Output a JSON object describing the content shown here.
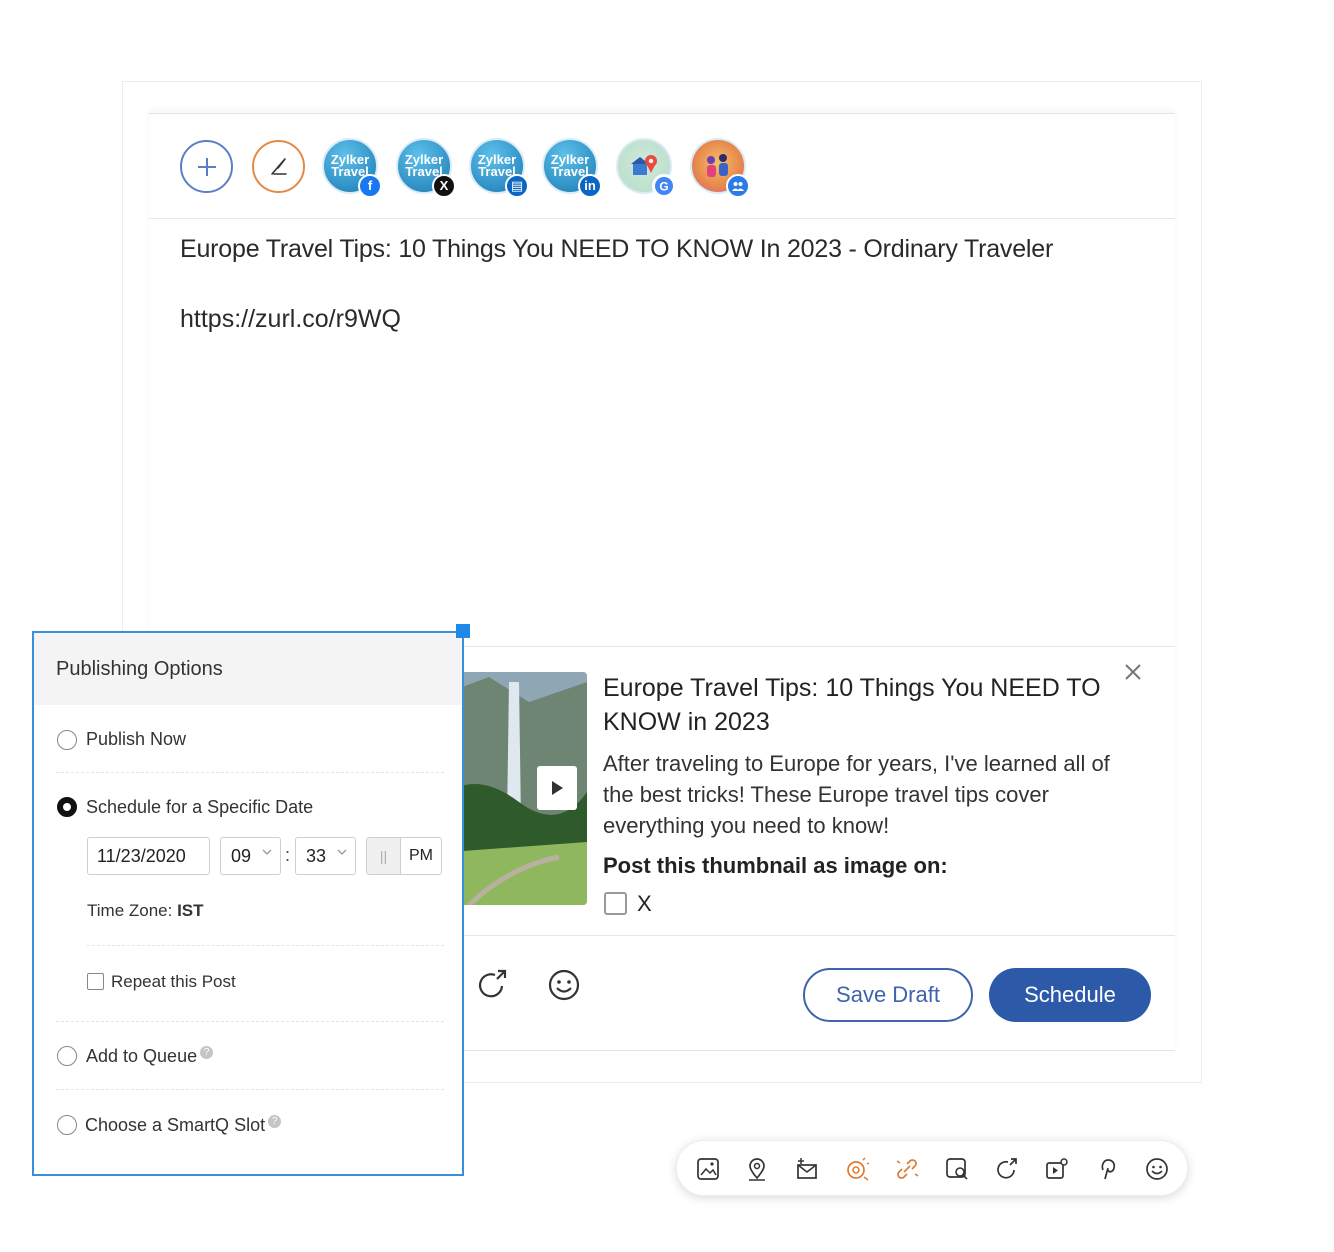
{
  "composer": {
    "post_text": "Europe Travel Tips: 10 Things You NEED TO KNOW In 2023 - Ordinary Traveler",
    "post_link": "https://zurl.co/r9WQ",
    "avatars": [
      {
        "name": "Zylker Travel",
        "line1": "Zylker",
        "line2": "Travel",
        "network": "facebook",
        "badge": "f",
        "badge_color": "#1877f2"
      },
      {
        "name": "Zylker Travel",
        "line1": "Zylker",
        "line2": "Travel",
        "network": "x",
        "badge": "X",
        "badge_color": "#111111"
      },
      {
        "name": "Zylker Travel",
        "line1": "Zylker",
        "line2": "Travel",
        "network": "linkedin-page",
        "badge": "▤",
        "badge_color": "#0a66c2"
      },
      {
        "name": "Zylker Travel",
        "line1": "Zylker",
        "line2": "Travel",
        "network": "linkedin",
        "badge": "in",
        "badge_color": "#0a66c2"
      }
    ]
  },
  "preview": {
    "title": "Europe Travel Tips: 10 Things You NEED TO KNOW in 2023",
    "description": "After traveling to Europe for years, I've learned all of the best tricks! These Europe travel tips cover everything you need to know!",
    "thumbnail_label": "Post this thumbnail as image on:",
    "checkbox_label": "X"
  },
  "actions": {
    "save_draft": "Save Draft",
    "schedule": "Schedule"
  },
  "publishing_options": {
    "title": "Publishing Options",
    "publish_now": "Publish Now",
    "schedule_specific": "Schedule for a Specific Date",
    "date": "11/23/2020",
    "hour": "09",
    "minute": "33",
    "time_sep": ":",
    "ampm_left": "||",
    "ampm": "PM",
    "timezone_label": "Time Zone:",
    "timezone_value": "IST",
    "repeat": "Repeat this Post",
    "add_queue": "Add to Queue",
    "smartq": "Choose a SmartQ Slot",
    "selected": "schedule_specific"
  },
  "colors": {
    "primary": "#2d5aa8",
    "panel_border": "#3b8de0",
    "accent_orange": "#e48a44"
  }
}
